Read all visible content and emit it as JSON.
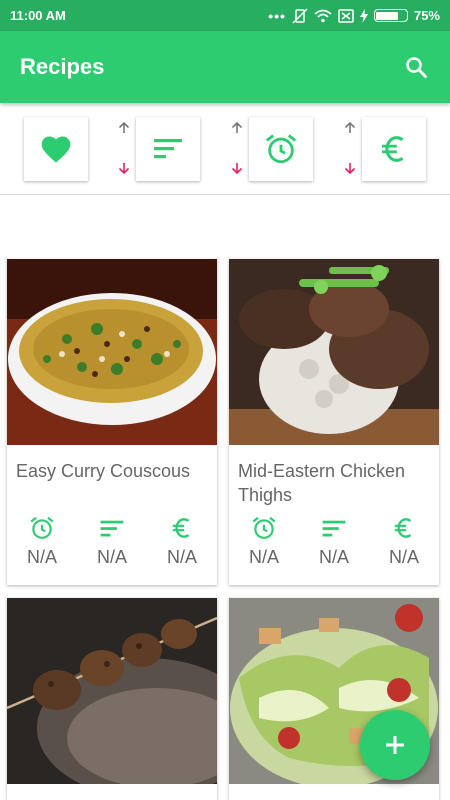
{
  "status_bar": {
    "time": "11:00 AM",
    "battery": "75%",
    "battery_level": 0.75
  },
  "app_bar": {
    "title": "Recipes"
  },
  "colors": {
    "primary": "#2ecc71",
    "dark": "#27ae60",
    "up_arrow": "#777777",
    "down_arrow": "#e91e63"
  },
  "filters": [
    {
      "icon": "heart-icon"
    },
    {
      "icon": "sort-lines-icon"
    },
    {
      "icon": "alarm-clock-icon"
    },
    {
      "icon": "euro-icon"
    }
  ],
  "recipes": [
    {
      "title": "Easy Curry Couscous",
      "time": "N/A",
      "difficulty": "N/A",
      "cost": "N/A"
    },
    {
      "title": "Mid-Eastern Chicken Thighs",
      "time": "N/A",
      "difficulty": "N/A",
      "cost": "N/A"
    },
    {
      "title": "",
      "time": "",
      "difficulty": "",
      "cost": ""
    },
    {
      "title": "",
      "time": "",
      "difficulty": "",
      "cost": ""
    }
  ],
  "fab": {
    "icon": "plus-icon"
  }
}
